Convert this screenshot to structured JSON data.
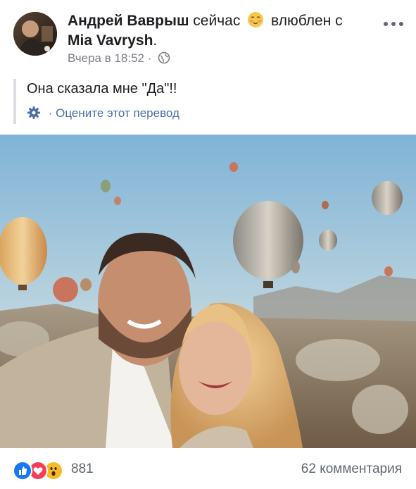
{
  "post": {
    "author": "Андрей Ваврыш",
    "status_prefix": "сейчас",
    "feeling": "влюблен с",
    "partner": "Mia Vavrysh",
    "period": ".",
    "timestamp": "Вчера в 18:52",
    "separator": "·",
    "privacy_icon": "globe-icon",
    "text": "Она сказала мне \"Да\"!!",
    "translate": {
      "icon": "gear-icon",
      "separator": "·",
      "label": "Оцените этот перевод"
    }
  },
  "footer": {
    "reactions": [
      "like-reaction-icon",
      "love-reaction-icon",
      "wow-reaction-icon"
    ],
    "reaction_count": "881",
    "comments": "62 комментария"
  },
  "colors": {
    "like": "#1877f2",
    "love": "#f33e58",
    "wow": "#f7b928",
    "link": "#4b6ea8",
    "muted": "#7a7f87"
  }
}
